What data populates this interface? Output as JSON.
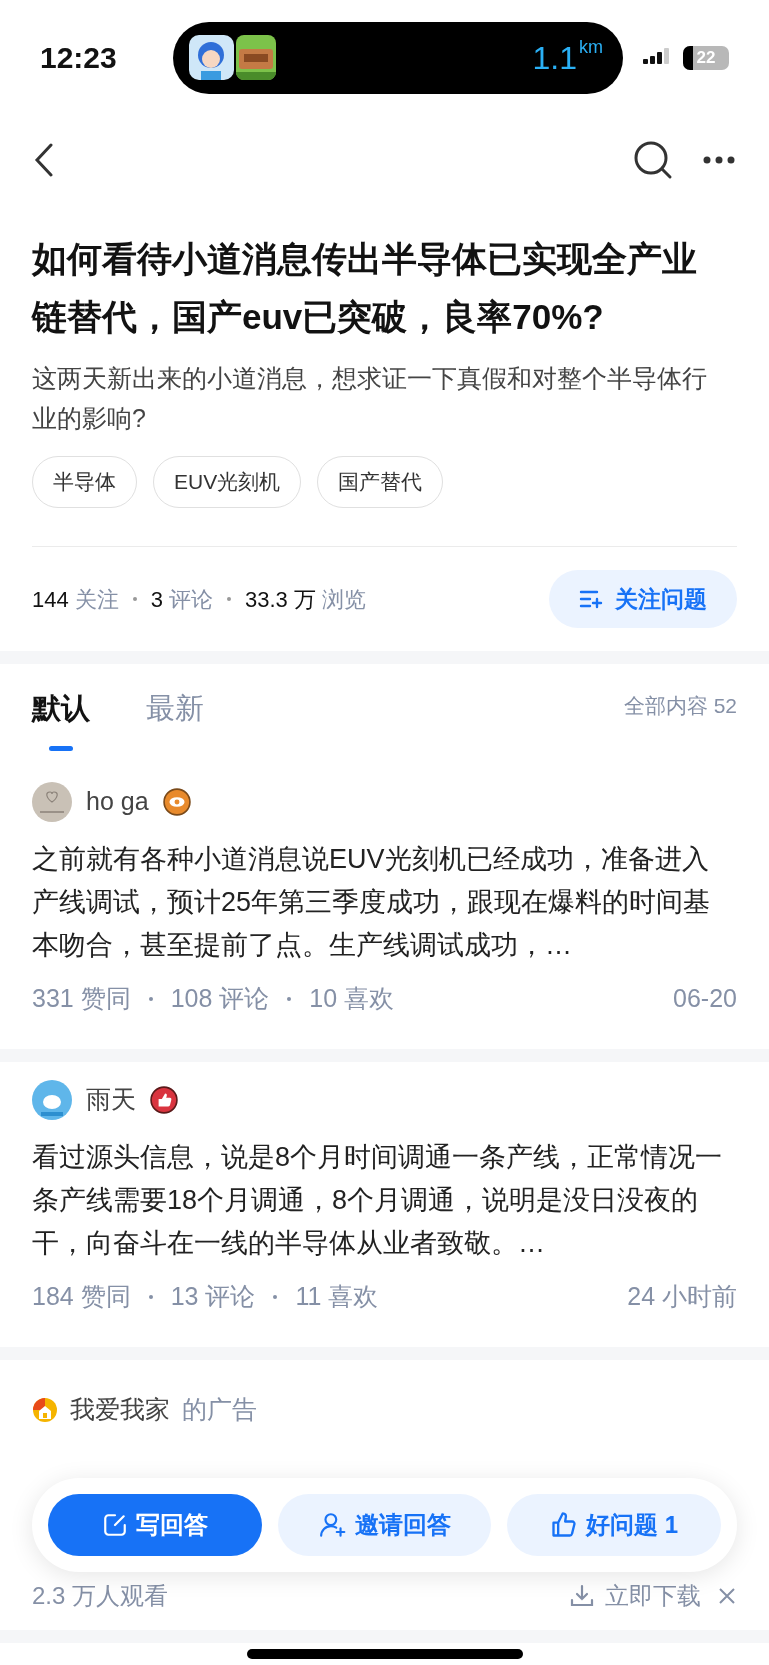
{
  "status_bar": {
    "time": "12:23",
    "island_distance": "1.1",
    "island_unit": "km",
    "battery": "22"
  },
  "question": {
    "title": "如何看待小道消息传出半导体已实现全产业链替代，国产euv已突破，良率70%?",
    "description": "这两天新出来的小道消息，想求证一下真假和对整个半导体行业的影响?",
    "tags": [
      "半导体",
      "EUV光刻机",
      "国产替代"
    ],
    "stats": [
      {
        "number": "144",
        "label": "关注"
      },
      {
        "number": "3",
        "label": "评论"
      },
      {
        "number": "33.3 万",
        "label": "浏览"
      }
    ],
    "follow_button": "关注问题"
  },
  "tabs": [
    {
      "label": "默认",
      "selected": true
    },
    {
      "label": "最新",
      "selected": false
    }
  ],
  "total": "全部内容 52",
  "answers": [
    {
      "author": "ho ga",
      "kind": "eye",
      "text": "之前就有各种小道消息说EUV光刻机已经成功，准备进入产线调试，预计25年第三季度成功，跟现在爆料的时间基本吻合，甚至提前了点。生产线调试成功，…",
      "stats": [
        "331 赞同",
        "108 评论",
        "10 喜欢"
      ],
      "time": "06-20"
    },
    {
      "author": "雨天",
      "kind": "thumb",
      "text": "看过源头信息，说是8个月时间调通一条产线，正常情况一条产线需要18个月调通，8个月调通，说明是没日没夜的干，向奋斗在一线的半导体从业者致敬。…",
      "stats": [
        "184 赞同",
        "13 评论",
        "11 喜欢"
      ],
      "time": "24 小时前"
    }
  ],
  "ad": {
    "advertiser": "我爱我家",
    "suffix": "的广告",
    "views": "2.3 万人观看",
    "download": "立即下载"
  },
  "bottom_bar": [
    {
      "kind": "primary",
      "label": "写回答"
    },
    {
      "kind": "invite",
      "label": "邀请回答"
    },
    {
      "kind": "like",
      "label": "好问题 1"
    }
  ]
}
